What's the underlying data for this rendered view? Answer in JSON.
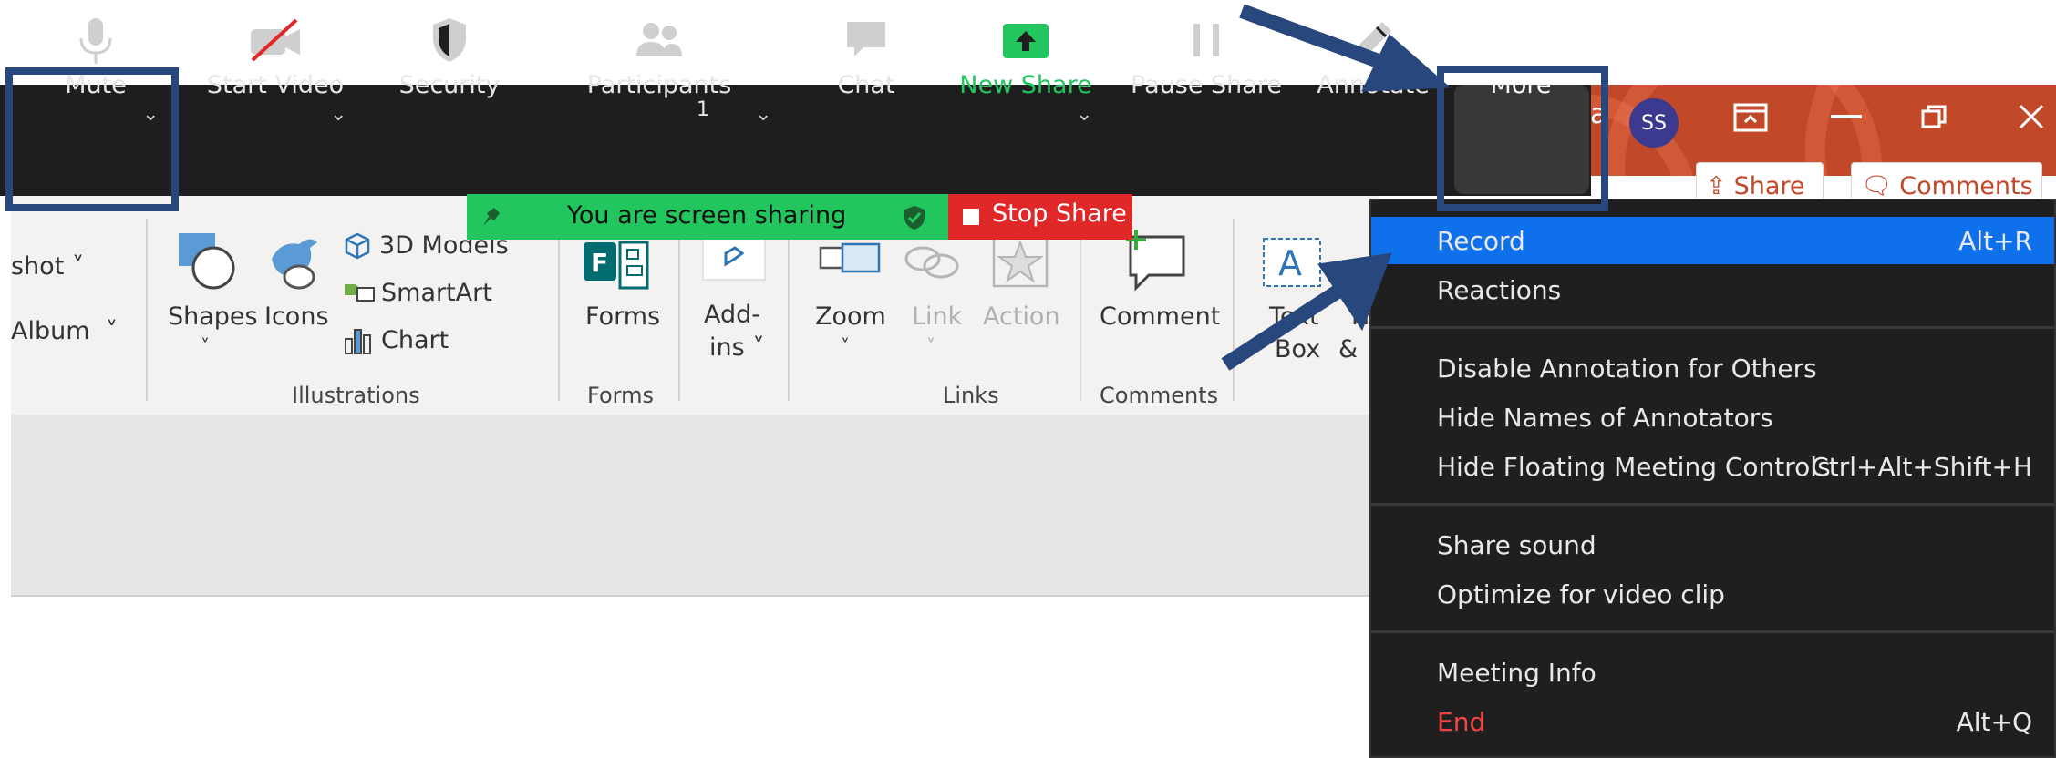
{
  "zoom_toolbar": {
    "mute": "Mute",
    "start_video": "Start Video",
    "security": "Security",
    "participants": "Participants",
    "participants_count": "1",
    "chat": "Chat",
    "new_share": "New Share",
    "pause_share": "Pause Share",
    "annotate": "Annotate",
    "more": "More",
    "colors": {
      "bar": "#1e1e1e",
      "green": "#22c55e",
      "text": "#e6e6e6"
    }
  },
  "share_banner": {
    "status": "You are screen sharing",
    "stop": "Stop Share"
  },
  "powerpoint": {
    "avatar_initials": "SS",
    "title_fragment": "a",
    "share_button": "Share",
    "comments_button": "Comments",
    "ribbon": {
      "screenshot": "shot",
      "album": "Album",
      "shapes": "Shapes",
      "icons": "Icons",
      "models_3d": "3D Models",
      "smartart": "SmartArt",
      "chart": "Chart",
      "forms": "Forms",
      "addins_1": "Add-",
      "addins_2": "ins",
      "zoom": "Zoom",
      "link": "Link",
      "action": "Action",
      "comment": "Comment",
      "textbox_1": "Text",
      "textbox_2": "Box",
      "header_1": "H",
      "header_2": "&",
      "groups": {
        "illustrations": "Illustrations",
        "forms": "Forms",
        "links": "Links",
        "comments": "Comments"
      }
    },
    "brand_color": "#c2482a"
  },
  "more_menu": {
    "items": [
      {
        "label": "Record",
        "shortcut": "Alt+R",
        "highlighted": true
      },
      {
        "label": "Reactions",
        "shortcut": ""
      },
      {
        "label": "Disable Annotation for Others",
        "shortcut": ""
      },
      {
        "label": "Hide Names of Annotators",
        "shortcut": ""
      },
      {
        "label": "Hide Floating Meeting Controls",
        "shortcut": "Ctrl+Alt+Shift+H"
      },
      {
        "label": "Share sound",
        "shortcut": ""
      },
      {
        "label": "Optimize for video clip",
        "shortcut": ""
      },
      {
        "label": "Meeting Info",
        "shortcut": ""
      },
      {
        "label": "End",
        "shortcut": "Alt+Q"
      }
    ],
    "highlight_color": "#0e71eb",
    "end_color": "#f24444"
  },
  "annotation_color": "#27477d"
}
